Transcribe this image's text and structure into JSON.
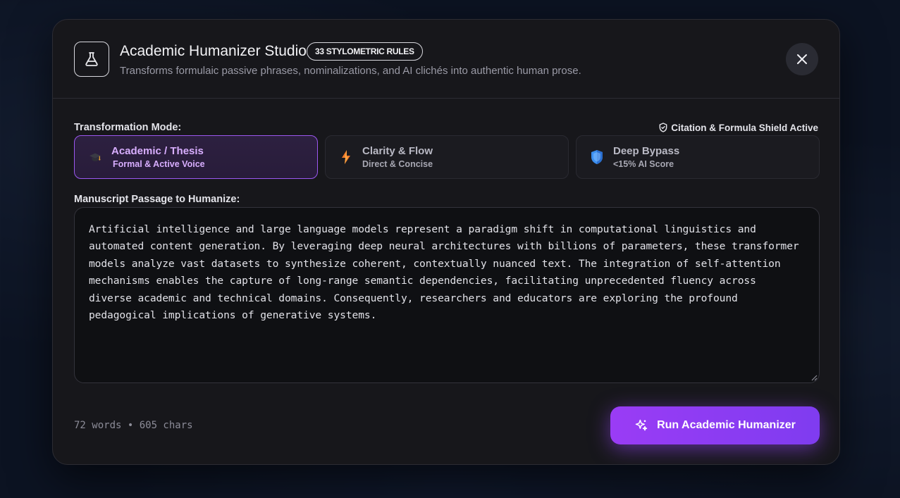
{
  "header": {
    "title": "Academic Humanizer Studio",
    "badge": "33 STYLOMETRIC RULES",
    "subtitle": "Transforms formulaic passive phrases, nominalizations, and AI clichés into authentic human prose."
  },
  "mode_section": {
    "label": "Transformation Mode:",
    "shield_status": "Citation & Formula Shield Active",
    "modes": [
      {
        "title": "Academic / Thesis",
        "subtitle": "Formal & Active Voice",
        "icon": "graduation-cap-icon",
        "active": true
      },
      {
        "title": "Clarity & Flow",
        "subtitle": "Direct & Concise",
        "icon": "lightning-icon",
        "active": false
      },
      {
        "title": "Deep Bypass",
        "subtitle": "<15% AI Score",
        "icon": "shield-icon",
        "active": false
      }
    ]
  },
  "passage": {
    "label": "Manuscript Passage to Humanize:",
    "text": "Artificial intelligence and large language models represent a paradigm shift in computational linguistics and automated content generation. By leveraging deep neural architectures with billions of parameters, these transformer models analyze vast datasets to synthesize coherent, contextually nuanced text. The integration of self-attention mechanisms enables the capture of long-range semantic dependencies, facilitating unprecedented fluency across diverse academic and technical domains. Consequently, researchers and educators are exploring the profound pedagogical implications of generative systems."
  },
  "footer": {
    "counter": "72 words • 605 chars",
    "run_label": "Run Academic Humanizer"
  },
  "colors": {
    "accent": "#9b57f0",
    "accent_text": "#d8aeff",
    "panel": "#17171b"
  }
}
